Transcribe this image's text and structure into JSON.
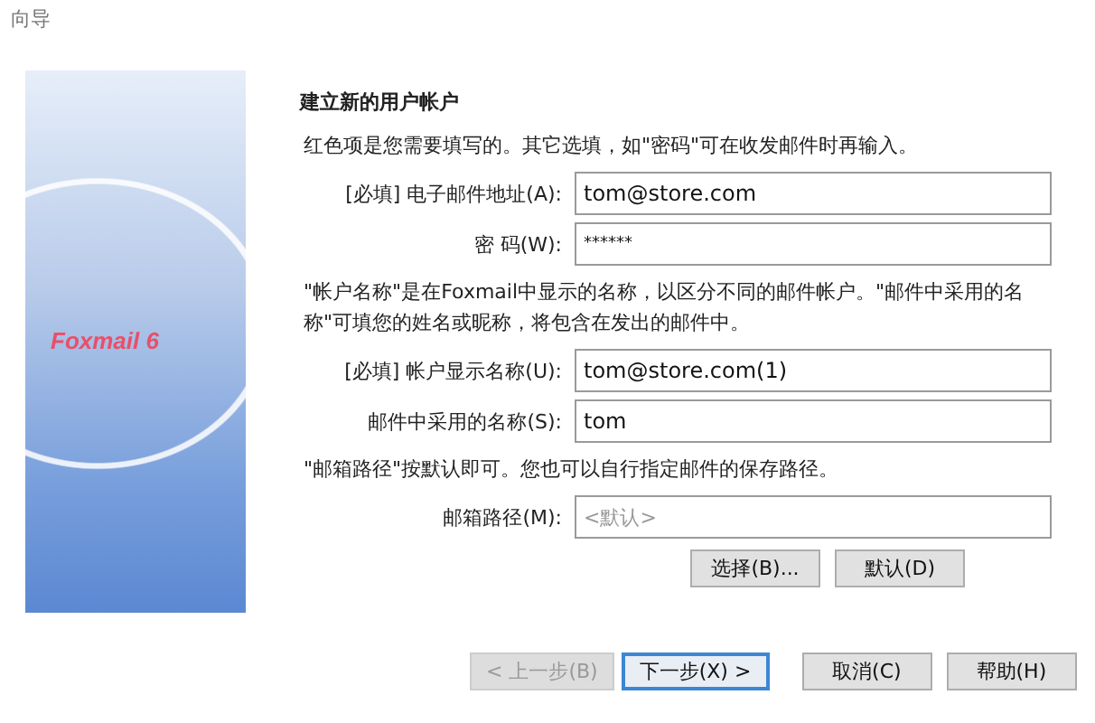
{
  "window": {
    "title": "向导"
  },
  "side_image": {
    "logo": "Foxmail 6"
  },
  "heading": "建立新的用户帐户",
  "sections": [
    {
      "note": "红色项是您需要填写的。其它选填，如\"密码\"可在收发邮件时再输入。",
      "fields": [
        {
          "label": "[必填] 电子邮件地址(A):",
          "value": "tom@store.com",
          "kind": "text"
        },
        {
          "label": "密 码(W):",
          "value": "******",
          "kind": "password"
        }
      ]
    },
    {
      "note": "\"帐户名称\"是在Foxmail中显示的名称，以区分不同的邮件帐户。\"邮件中采用的名称\"可填您的姓名或昵称，将包含在发出的邮件中。",
      "fields": [
        {
          "label": "[必填] 帐户显示名称(U):",
          "value": "tom@store.com(1)",
          "kind": "text"
        },
        {
          "label": "邮件中采用的名称(S):",
          "value": "tom",
          "kind": "text"
        }
      ]
    },
    {
      "note": "\"邮箱路径\"按默认即可。您也可以自行指定邮件的保存路径。",
      "fields": [
        {
          "label": "邮箱路径(M):",
          "placeholder": "<默认>",
          "kind": "text"
        }
      ],
      "buttons": [
        "选择(B)...",
        "默认(D)"
      ]
    }
  ],
  "footer_buttons": [
    {
      "label": "< 上一步(B)",
      "disabled": true,
      "default": false
    },
    {
      "label": "下一步(X) >",
      "disabled": false,
      "default": true
    },
    {
      "label": "取消(C)",
      "disabled": false,
      "default": false
    },
    {
      "label": "帮助(H)",
      "disabled": false,
      "default": false
    }
  ]
}
